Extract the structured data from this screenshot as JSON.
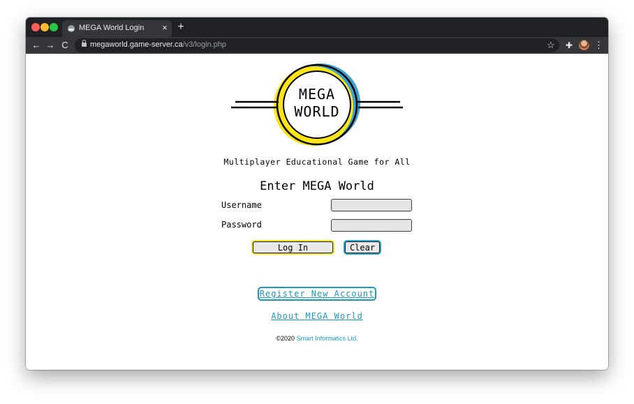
{
  "browser": {
    "tab": {
      "title": "MEGA World Login",
      "close_glyph": "×"
    },
    "new_tab_glyph": "+",
    "nav": {
      "back_glyph": "←",
      "forward_glyph": "→",
      "reload_glyph": "C"
    },
    "address": {
      "host": "megaworld.game-server.ca",
      "path": "/v3/login.php"
    },
    "toolbar_icons": {
      "star_glyph": "☆",
      "extension_glyph": "✚",
      "menu_glyph": "⋮"
    }
  },
  "logo": {
    "line1": "MEGA",
    "line2": "WORLD",
    "colors": {
      "blue": "#3aa3d3",
      "yellow": "#ffe413",
      "ink": "#000000"
    }
  },
  "tagline": "Multiplayer Educational Game for All",
  "form": {
    "title": "Enter MEGA World",
    "username_label": "Username",
    "password_label": "Password",
    "username_value": "",
    "password_value": "",
    "login_label": "Log In",
    "clear_label": "Clear"
  },
  "links": {
    "register": "Register New Account",
    "about": "About MEGA World"
  },
  "footer": {
    "copyright": "©2020",
    "company": "Smart Informatics Ltd."
  },
  "colors": {
    "link": "#1a97c5",
    "login_focus": "#f3e21c",
    "clear_focus": "#2ea1cf",
    "input_bg": "#e5e5e5"
  }
}
